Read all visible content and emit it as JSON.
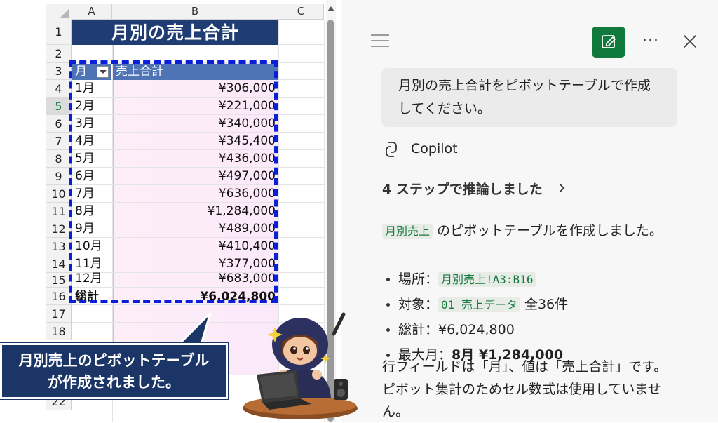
{
  "sheet": {
    "columns": [
      "A",
      "B",
      "C"
    ],
    "rows": [
      "1",
      "2",
      "3",
      "4",
      "5",
      "6",
      "7",
      "8",
      "9",
      "10",
      "11",
      "12",
      "13",
      "14",
      "15",
      "16",
      "17",
      "18",
      "22"
    ],
    "selected_row": "5",
    "title": "月別の売上合計",
    "pivot": {
      "header_month": "月",
      "header_total": "売上合計",
      "rows": [
        {
          "month": "1月",
          "value": "¥306,000"
        },
        {
          "month": "2月",
          "value": "¥221,000"
        },
        {
          "month": "3月",
          "value": "¥340,000"
        },
        {
          "month": "4月",
          "value": "¥345,400"
        },
        {
          "month": "5月",
          "value": "¥436,000"
        },
        {
          "month": "6月",
          "value": "¥497,000"
        },
        {
          "month": "7月",
          "value": "¥636,000"
        },
        {
          "month": "8月",
          "value": "¥1,284,000"
        },
        {
          "month": "9月",
          "value": "¥489,000"
        },
        {
          "month": "10月",
          "value": "¥410,400"
        },
        {
          "month": "11月",
          "value": "¥377,000"
        },
        {
          "month": "12月",
          "value": "¥683,000"
        }
      ],
      "total_label": "総計",
      "total_value": "¥6,024,800"
    }
  },
  "copilot": {
    "user_message": "月別の売上合計をピボットテーブルで作成してください。",
    "assistant_name": "Copilot",
    "reasoning": "4 ステップで推論しました",
    "result_sheet": "月別売上",
    "result_text": "のピボットテーブルを作成しました。",
    "bullets": [
      {
        "label": "場所：",
        "code": "月別売上!A3:B16",
        "suffix": ""
      },
      {
        "label": "対象：",
        "code": "01_売上データ",
        "suffix": "全36件"
      },
      {
        "label": "総計：¥6,024,800",
        "code": "",
        "suffix": ""
      },
      {
        "label": "最大月：",
        "bold": "8月 ¥1,284,000"
      }
    ],
    "note": "行フィールドは「月」、値は「売上合計」です。ピボット集計のためセル数式は使用していません。"
  },
  "callout": {
    "line1": "月別売上のピボットテーブル",
    "line2": "が作成されました。"
  },
  "colors": {
    "title_bg": "#1f3d73",
    "pivot_header": "#4f74b5",
    "dash_border": "#0a1fd8",
    "copilot_green": "#0f7a3b",
    "callout_bg": "#1b3566"
  }
}
